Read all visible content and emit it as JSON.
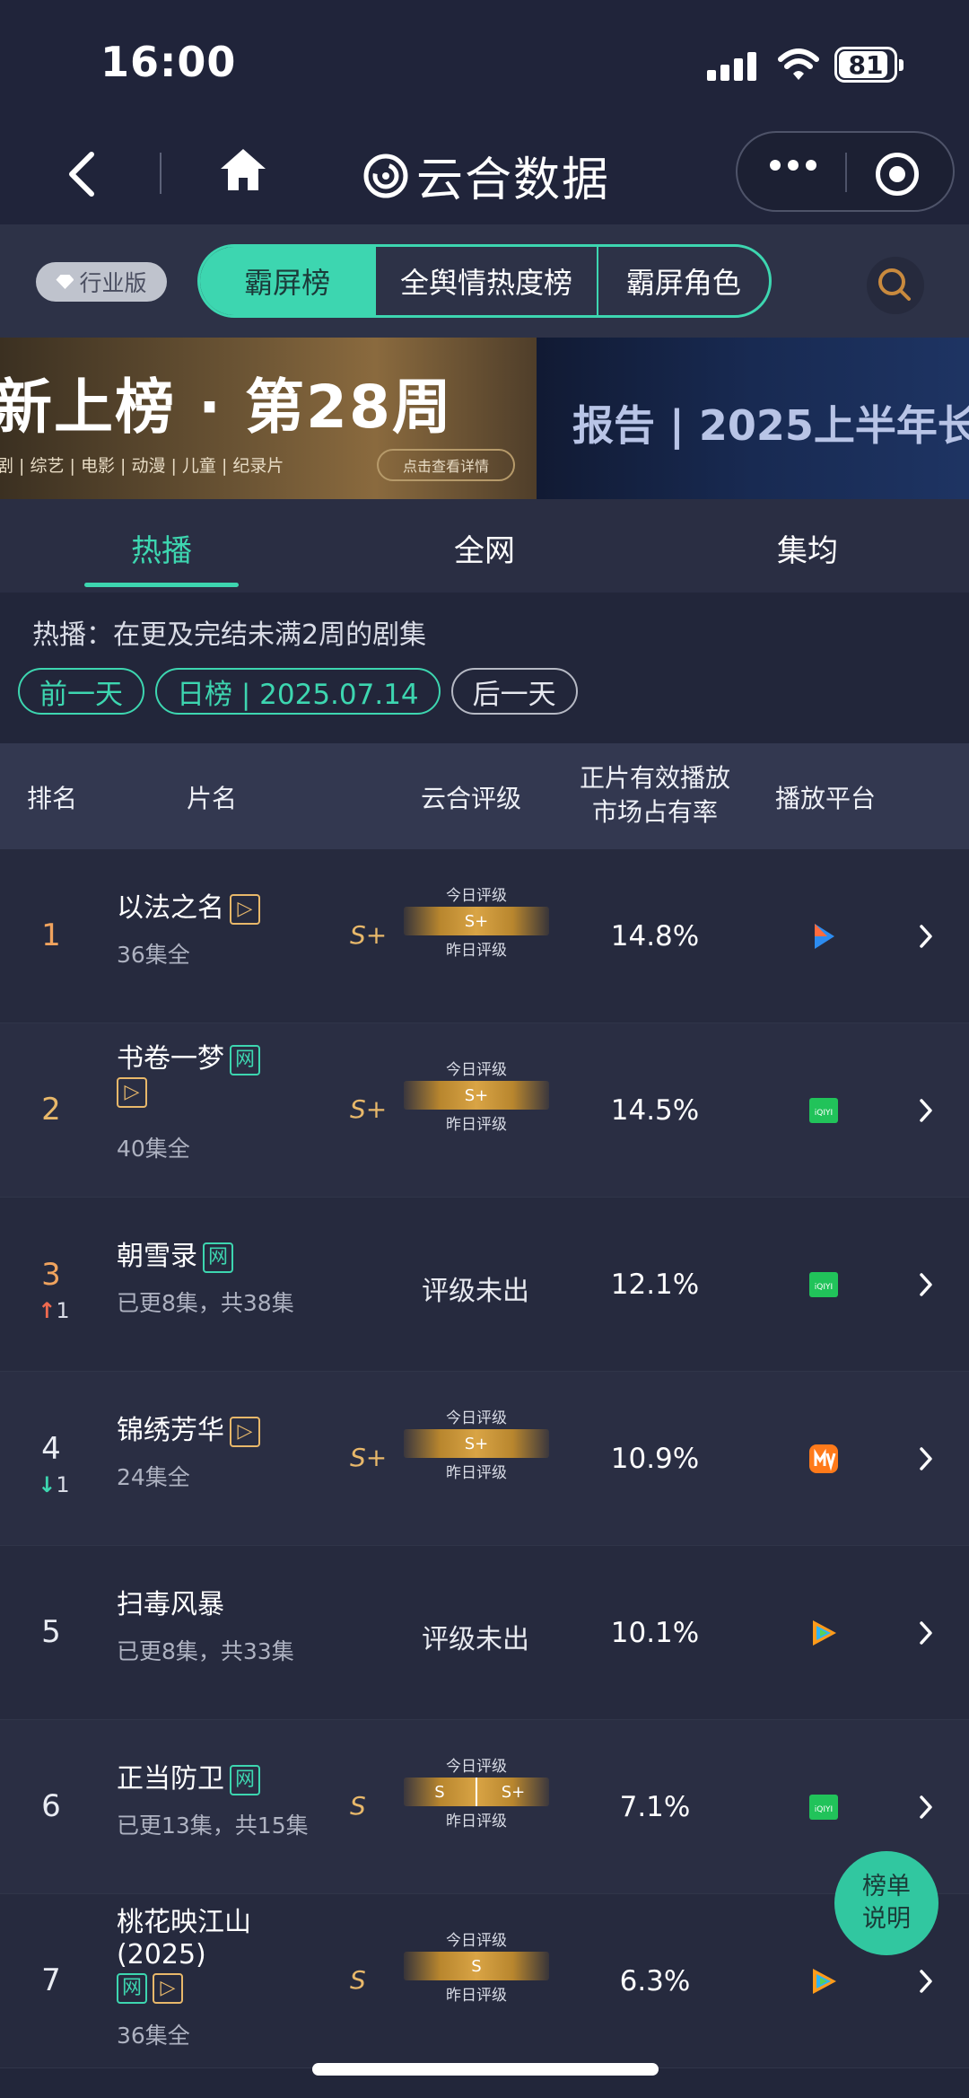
{
  "status_bar": {
    "time": "16:00",
    "battery": "81"
  },
  "nav": {
    "app_name": "云合数据"
  },
  "category": {
    "industry_badge": "行业版",
    "segments": [
      "霸屏榜",
      "全舆情热度榜",
      "霸屏角色"
    ],
    "active_segment": "霸屏榜"
  },
  "banner": {
    "left_title": "新上榜 · 第28周",
    "left_subtitle": "剧 | 综艺 | 电影 | 动漫 | 儿童 | 纪录片",
    "left_button": "点击查看详情",
    "right_title": "报告 | 2025上半年长"
  },
  "main_tabs": [
    "热播",
    "全网",
    "集均"
  ],
  "description": "热播：在更及完结未满2周的剧集",
  "date_nav": {
    "prev": "前一天",
    "current": "日榜 | 2025.07.14",
    "next": "后一天"
  },
  "table_header": {
    "rank": "排名",
    "title": "片名",
    "rating": "云合评级",
    "share_line1": "正片有效播放",
    "share_line2": "市场占有率",
    "platform": "播放平台"
  },
  "rating_labels": {
    "today": "今日评级",
    "yesterday": "昨日评级",
    "unrated": "评级未出"
  },
  "rows": [
    {
      "rank": "1",
      "title_line1": "以法之名",
      "title_line2": "",
      "tags": [
        "play"
      ],
      "tags_newline": false,
      "sub": "36集全",
      "grade": "S+",
      "bar_left": "S+",
      "bar_right": "",
      "split": false,
      "share": "14.8%",
      "platform": "youku"
    },
    {
      "rank": "2",
      "title_line1": "书卷一梦",
      "title_line2": "",
      "tags": [
        "wang",
        "play"
      ],
      "tags_newline": true,
      "sub": "40集全",
      "grade": "S+",
      "bar_left": "S+",
      "bar_right": "",
      "split": false,
      "share": "14.5%",
      "platform": "iqiyi"
    },
    {
      "rank": "3",
      "delta": "1",
      "delta_dir": "up",
      "title_line1": "朝雪录",
      "title_line2": "",
      "tags": [
        "wang"
      ],
      "tags_newline": false,
      "sub": "已更8集，共38集",
      "grade": "",
      "unrated": true,
      "share": "12.1%",
      "platform": "iqiyi"
    },
    {
      "rank": "4",
      "delta": "1",
      "delta_dir": "down",
      "title_line1": "锦绣芳华",
      "title_line2": "",
      "tags": [
        "play"
      ],
      "tags_newline": false,
      "sub": "24集全",
      "grade": "S+",
      "bar_left": "S+",
      "bar_right": "",
      "split": false,
      "share": "10.9%",
      "platform": "mgtv"
    },
    {
      "rank": "5",
      "title_line1": "扫毒风暴",
      "title_line2": "",
      "tags": [],
      "tags_newline": false,
      "sub": "已更8集，共33集",
      "grade": "",
      "unrated": true,
      "share": "10.1%",
      "platform": "tencent"
    },
    {
      "rank": "6",
      "title_line1": "正当防卫",
      "title_line2": "",
      "tags": [
        "wang"
      ],
      "tags_newline": false,
      "sub": "已更13集，共15集",
      "grade": "S",
      "bar_left": "S",
      "bar_right": "S+",
      "split": true,
      "share": "7.1%",
      "platform": "iqiyi"
    },
    {
      "rank": "7",
      "title_line1": "桃花映江山",
      "title_line2": "(2025)",
      "tags": [
        "wang",
        "play"
      ],
      "tags_newline": true,
      "sub": "36集全",
      "grade": "S",
      "bar_left": "S",
      "bar_right": "",
      "split": false,
      "share": "6.3%",
      "platform": "tencent"
    }
  ],
  "tag_labels": {
    "wang": "网",
    "play": "▷"
  },
  "fab": {
    "line1": "榜单",
    "line2": "说明"
  },
  "colors": {
    "accent": "#3dd6b0",
    "gold": "#e8b86a",
    "up": "#f06a4f",
    "down": "#3dd6b0"
  }
}
